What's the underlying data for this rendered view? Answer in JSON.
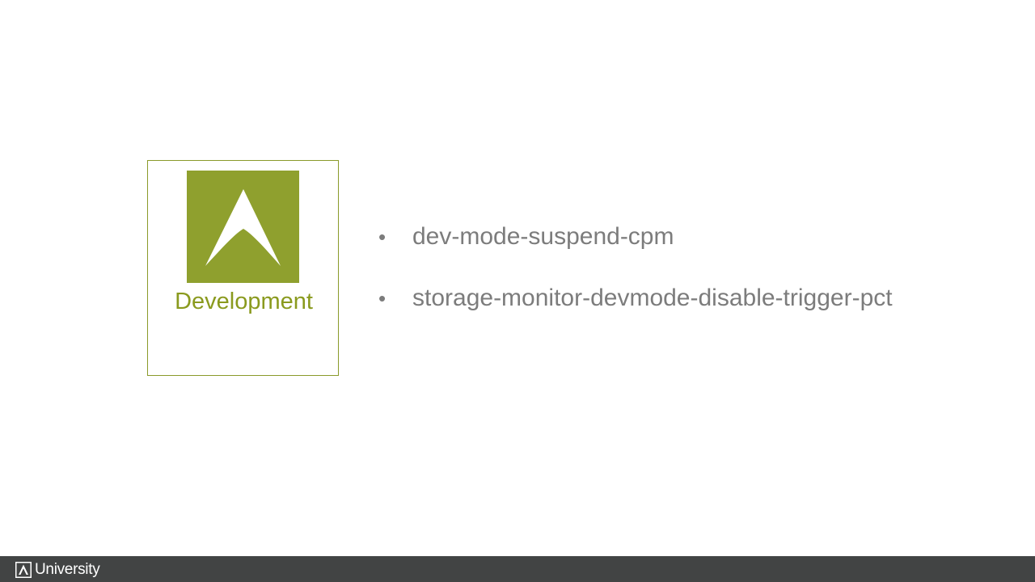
{
  "card": {
    "icon": "arrow-a-logo-icon",
    "label": "Development",
    "color": "#8a9a2a",
    "icon_bg": "#8fa02e"
  },
  "bullets": [
    {
      "text": "dev-mode-suspend-cpm"
    },
    {
      "text": "storage-monitor-devmode-disable-trigger-pct"
    }
  ],
  "bullet_char": "•",
  "footer": {
    "logo_icon": "a-logo-icon",
    "brand_text": "University",
    "background": "#424444"
  }
}
